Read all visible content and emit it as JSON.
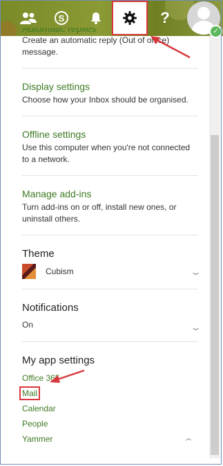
{
  "topbar": {
    "people_icon": "people-icon",
    "skype_icon": "skype-icon",
    "bell_icon": "bell-icon",
    "gear_icon": "gear-icon",
    "help_label": "?",
    "avatar_icon": "avatar-icon"
  },
  "settings": {
    "auto_reply": {
      "title": "Automatic replies",
      "description": "Create an automatic reply (Out of office) message."
    },
    "display": {
      "title": "Display settings",
      "description": "Choose how your Inbox should be organised."
    },
    "offline": {
      "title": "Offline settings",
      "description": "Use this computer when you're not connected to a network."
    },
    "addins": {
      "title": "Manage add-ins",
      "description": "Turn add-ins on or off, install new ones, or uninstall others."
    },
    "theme": {
      "title": "Theme",
      "value": "Cubism"
    },
    "notifications": {
      "title": "Notifications",
      "value": "On"
    },
    "app_settings": {
      "title": "My app settings",
      "items": [
        "Office 365",
        "Mail",
        "Calendar",
        "People",
        "Yammer"
      ]
    }
  },
  "colors": {
    "accent_green": "#3d7a23",
    "highlight_red": "#d9373b"
  }
}
